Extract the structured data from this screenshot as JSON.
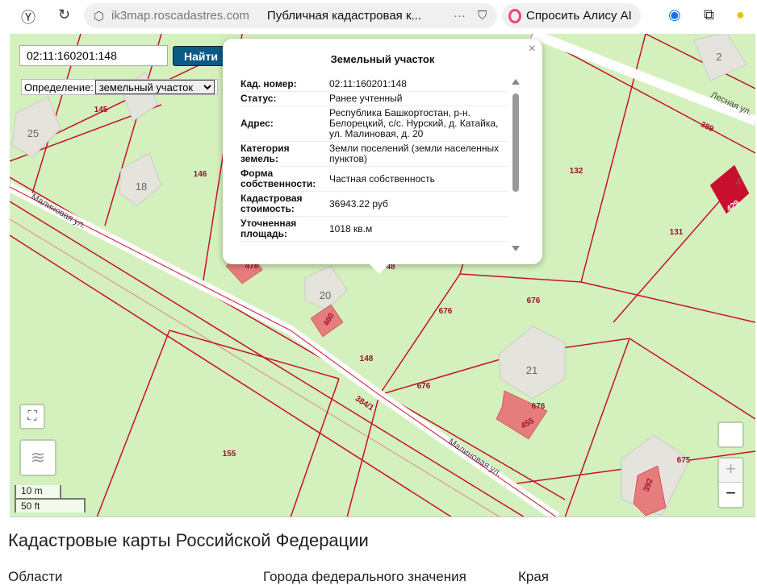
{
  "browser": {
    "url": "ik3map.roscadastres.com",
    "tab_title": "Публичная кадастровая к...",
    "alice_label": "Спросить Алису AI",
    "icons": [
      "yandex-icon",
      "reload-icon",
      "shield-icon",
      "more-icon",
      "bookmark-icon",
      "alice-icon",
      "vpn-icon",
      "extensions-icon",
      "profile-icon"
    ]
  },
  "search": {
    "value": "02:11:160201:148",
    "button": "Найти",
    "definition_label": "Определение:",
    "definition_value": "земельный участок"
  },
  "popup": {
    "title": "Земельный участок",
    "close": "×",
    "rows": [
      {
        "k": "Кад. номер:",
        "v": "02:11:160201:148"
      },
      {
        "k": "Статус:",
        "v": "Ранее учтенный"
      },
      {
        "k": "Адрес:",
        "v": "Республика Башкортостан, р-н. Белорецкий, с/с. Нурский, д. Катайка, ул. Малиновая, д. 20"
      },
      {
        "k": "Категория земель:",
        "v": "Земли поселений (земли населенных пунктов)"
      },
      {
        "k": "Форма собственности:",
        "v": "Частная собственность"
      },
      {
        "k": "Кадастровая стоимость:",
        "v": "36943.22 руб"
      },
      {
        "k": "Уточненная площадь:",
        "v": "1018 кв.м"
      }
    ]
  },
  "map": {
    "streets": [
      "Малиновая ул.",
      "Малиновая ул.",
      "Лесная ул."
    ],
    "parcels": [
      "145",
      "146",
      "132",
      "131",
      "389",
      "676",
      "676",
      "148",
      "676",
      "676",
      "155",
      "675",
      "384/1",
      "429",
      "460",
      "455",
      "392",
      "478",
      "48"
    ],
    "houses": [
      "25",
      "18",
      "20",
      "21",
      "2",
      "4"
    ],
    "scale": {
      "metric": "10 m",
      "imperial": "50 ft"
    },
    "zoom_in": "+",
    "zoom_out": "−",
    "colors": {
      "land": "#d3f0bd",
      "boundary": "#c8102e",
      "building": "#e57d7d"
    }
  },
  "page": {
    "heading": "Кадастровые карты Российской Федерации",
    "columns": [
      "Области",
      "Города федерального значения",
      "Края"
    ]
  }
}
